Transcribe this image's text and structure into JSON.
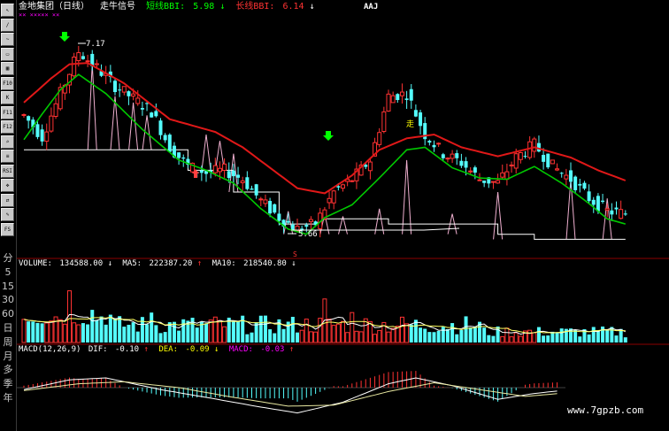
{
  "toolbar": {
    "buttons": [
      {
        "name": "cursor-button",
        "label": "↖"
      },
      {
        "name": "line-tool-button",
        "label": "/"
      },
      {
        "name": "trend-tool-button",
        "label": "~"
      },
      {
        "name": "window-button",
        "label": "▭"
      },
      {
        "name": "layout-button",
        "label": "▦"
      },
      {
        "name": "f10-button",
        "label": "F10"
      },
      {
        "name": "kline-button",
        "label": "K"
      },
      {
        "name": "f11-button",
        "label": "F11"
      },
      {
        "name": "f12-button",
        "label": "F12"
      },
      {
        "name": "zoom-button",
        "label": "⌕"
      },
      {
        "name": "indicator-button",
        "label": "≡"
      },
      {
        "name": "rsi-button",
        "label": "RSI"
      },
      {
        "name": "move-button",
        "label": "✥"
      },
      {
        "name": "arrows-button",
        "label": "⇄"
      },
      {
        "name": "draw-button",
        "label": "✎"
      },
      {
        "name": "fs-button",
        "label": "FS"
      }
    ],
    "period_labels": [
      "分",
      "5",
      "15",
      "30",
      "60",
      "日",
      "周",
      "月",
      "多",
      "季",
      "年"
    ]
  },
  "header": {
    "stock": "金地集团（日线）",
    "indicator": "走牛信号",
    "short_label": "短线BBI:",
    "short_value": "5.98",
    "short_arrow": "↓",
    "long_label": "长线BBI:",
    "long_value": "6.14",
    "long_arrow": "↓",
    "right_tag": "AAJ"
  },
  "markers": {
    "high_label": "7.17",
    "low_label": "5.66",
    "walk_label": "走",
    "row_marks": "×× ××××× ××",
    "s_mark": "S"
  },
  "volume_panel": {
    "label": "VOLUME:",
    "value": "134588.00",
    "arrow": "↓",
    "ma5_label": "MA5:",
    "ma5_value": "222387.20",
    "ma5_arrow": "↑",
    "ma10_label": "MA10:",
    "ma10_value": "218540.80",
    "ma10_arrow": "↓"
  },
  "macd_panel": {
    "label": "MACD(12,26,9)",
    "dif_label": "DIF:",
    "dif_value": "-0.10",
    "dif_arrow": "↑",
    "dea_label": "DEA:",
    "dea_value": "-0.09",
    "dea_arrow": "↓",
    "macd_label": "MACD:",
    "macd_value": "-0.03",
    "macd_arrow": "↑"
  },
  "watermark": "www.7gpzb.com",
  "colors": {
    "up": "#ff3232",
    "down": "#54fcfc",
    "bbi_long": "#e01818",
    "bbi_short": "#00c800",
    "header_short": "#00ff00",
    "header_long": "#ff3232",
    "grid": "#8b0000",
    "axis_text": "#c0c0c0",
    "macd_label": "#ff00ff",
    "dea_label": "#ffff00"
  },
  "chart_data": [
    {
      "type": "candlestick",
      "panel": "price",
      "title": "金地集团（日线）",
      "high_annotation": 7.17,
      "low_annotation": 5.66,
      "ylim": [
        5.5,
        7.3
      ],
      "series": [
        {
          "name": "短线BBI",
          "last": 5.98
        },
        {
          "name": "长线BBI",
          "last": 6.14
        }
      ],
      "price_path": [
        {
          "i": 0,
          "p": 6.55
        },
        {
          "i": 4,
          "p": 6.38
        },
        {
          "i": 8,
          "p": 6.72
        },
        {
          "i": 12,
          "p": 7.05
        },
        {
          "i": 16,
          "p": 6.92
        },
        {
          "i": 20,
          "p": 6.78
        },
        {
          "i": 24,
          "p": 6.68
        },
        {
          "i": 28,
          "p": 6.58
        },
        {
          "i": 32,
          "p": 6.3
        },
        {
          "i": 36,
          "p": 6.15
        },
        {
          "i": 40,
          "p": 6.1
        },
        {
          "i": 44,
          "p": 6.12
        },
        {
          "i": 48,
          "p": 6.05
        },
        {
          "i": 52,
          "p": 5.88
        },
        {
          "i": 56,
          "p": 5.75
        },
        {
          "i": 60,
          "p": 5.66
        },
        {
          "i": 64,
          "p": 5.7
        },
        {
          "i": 68,
          "p": 5.95
        },
        {
          "i": 72,
          "p": 6.05
        },
        {
          "i": 76,
          "p": 6.2
        },
        {
          "i": 80,
          "p": 6.7
        },
        {
          "i": 84,
          "p": 6.72
        },
        {
          "i": 88,
          "p": 6.4
        },
        {
          "i": 92,
          "p": 6.25
        },
        {
          "i": 96,
          "p": 6.18
        },
        {
          "i": 100,
          "p": 6.05
        },
        {
          "i": 104,
          "p": 6.02
        },
        {
          "i": 108,
          "p": 6.22
        },
        {
          "i": 112,
          "p": 6.32
        },
        {
          "i": 116,
          "p": 6.15
        },
        {
          "i": 120,
          "p": 6.05
        },
        {
          "i": 124,
          "p": 5.9
        },
        {
          "i": 128,
          "p": 5.8
        },
        {
          "i": 132,
          "p": 5.78
        }
      ],
      "bbi_long": [
        {
          "i": 0,
          "v": 6.65
        },
        {
          "i": 6,
          "v": 6.84
        },
        {
          "i": 10,
          "v": 6.95
        },
        {
          "i": 14,
          "v": 6.96
        },
        {
          "i": 22,
          "v": 6.8
        },
        {
          "i": 32,
          "v": 6.52
        },
        {
          "i": 42,
          "v": 6.42
        },
        {
          "i": 48,
          "v": 6.3
        },
        {
          "i": 54,
          "v": 6.14
        },
        {
          "i": 60,
          "v": 5.98
        },
        {
          "i": 66,
          "v": 5.94
        },
        {
          "i": 72,
          "v": 6.08
        },
        {
          "i": 78,
          "v": 6.28
        },
        {
          "i": 84,
          "v": 6.37
        },
        {
          "i": 90,
          "v": 6.4
        },
        {
          "i": 96,
          "v": 6.3
        },
        {
          "i": 104,
          "v": 6.23
        },
        {
          "i": 112,
          "v": 6.3
        },
        {
          "i": 120,
          "v": 6.22
        },
        {
          "i": 126,
          "v": 6.12
        },
        {
          "i": 132,
          "v": 6.04
        }
      ],
      "bbi_short": [
        {
          "i": 0,
          "v": 6.36
        },
        {
          "i": 4,
          "v": 6.56
        },
        {
          "i": 8,
          "v": 6.75
        },
        {
          "i": 12,
          "v": 6.87
        },
        {
          "i": 18,
          "v": 6.72
        },
        {
          "i": 26,
          "v": 6.44
        },
        {
          "i": 34,
          "v": 6.2
        },
        {
          "i": 40,
          "v": 6.12
        },
        {
          "i": 46,
          "v": 6.02
        },
        {
          "i": 52,
          "v": 5.82
        },
        {
          "i": 58,
          "v": 5.66
        },
        {
          "i": 62,
          "v": 5.62
        },
        {
          "i": 66,
          "v": 5.75
        },
        {
          "i": 72,
          "v": 5.85
        },
        {
          "i": 78,
          "v": 6.06
        },
        {
          "i": 84,
          "v": 6.28
        },
        {
          "i": 88,
          "v": 6.3
        },
        {
          "i": 94,
          "v": 6.14
        },
        {
          "i": 100,
          "v": 6.06
        },
        {
          "i": 106,
          "v": 6.05
        },
        {
          "i": 112,
          "v": 6.15
        },
        {
          "i": 118,
          "v": 6.02
        },
        {
          "i": 124,
          "v": 5.86
        },
        {
          "i": 128,
          "v": 5.74
        },
        {
          "i": 132,
          "v": 5.7
        }
      ]
    },
    {
      "type": "bar",
      "panel": "volume",
      "y_ticks": [
        5,
        15,
        30,
        60
      ],
      "series": [
        {
          "name": "VOLUME",
          "last": 134588.0
        },
        {
          "name": "MA5",
          "last": 222387.2
        },
        {
          "name": "MA10",
          "last": 218540.8
        }
      ]
    },
    {
      "type": "bar",
      "panel": "macd",
      "series": [
        {
          "name": "DIF",
          "last": -0.1
        },
        {
          "name": "DEA",
          "last": -0.09
        },
        {
          "name": "MACD",
          "last": -0.03
        }
      ],
      "dif_path": [
        {
          "i": 0,
          "v": -0.02
        },
        {
          "i": 10,
          "v": 0.08
        },
        {
          "i": 18,
          "v": 0.1
        },
        {
          "i": 30,
          "v": -0.02
        },
        {
          "i": 40,
          "v": -0.1
        },
        {
          "i": 52,
          "v": -0.2
        },
        {
          "i": 60,
          "v": -0.26
        },
        {
          "i": 70,
          "v": -0.15
        },
        {
          "i": 80,
          "v": 0.04
        },
        {
          "i": 86,
          "v": 0.1
        },
        {
          "i": 94,
          "v": 0.02
        },
        {
          "i": 104,
          "v": -0.12
        },
        {
          "i": 112,
          "v": -0.06
        },
        {
          "i": 120,
          "v": -0.02
        },
        {
          "i": 132,
          "v": -0.1
        }
      ],
      "dea_path": [
        {
          "i": 0,
          "v": -0.03
        },
        {
          "i": 12,
          "v": 0.04
        },
        {
          "i": 22,
          "v": 0.06
        },
        {
          "i": 34,
          "v": 0.0
        },
        {
          "i": 46,
          "v": -0.1
        },
        {
          "i": 58,
          "v": -0.19
        },
        {
          "i": 68,
          "v": -0.18
        },
        {
          "i": 80,
          "v": -0.04
        },
        {
          "i": 90,
          "v": 0.05
        },
        {
          "i": 100,
          "v": -0.02
        },
        {
          "i": 110,
          "v": -0.09
        },
        {
          "i": 120,
          "v": -0.05
        },
        {
          "i": 132,
          "v": -0.09
        }
      ]
    }
  ]
}
